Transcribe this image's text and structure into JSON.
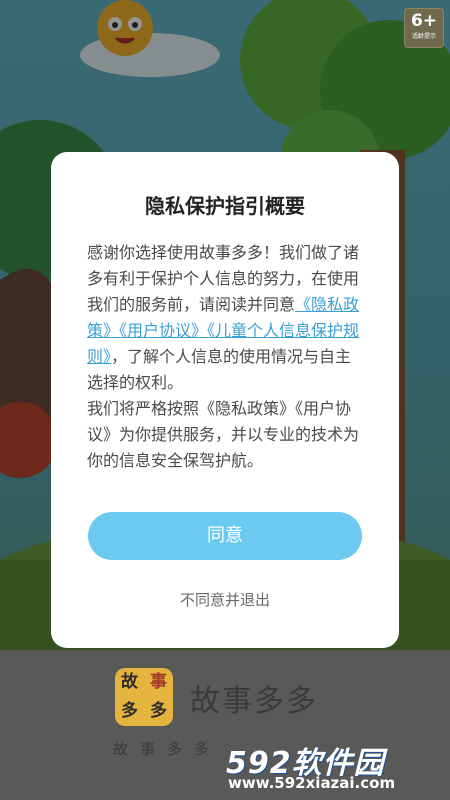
{
  "age_badge": {
    "rating": "6+",
    "caption": "适龄提示"
  },
  "dialog": {
    "title": "隐私保护指引概要",
    "body": {
      "intro": "感谢你选择使用故事多多！我们做了诸多有利于保护个人信息的努力，在使用我们的服务前，请阅读并同意",
      "link_privacy": "《隐私政策》",
      "link_user_agreement": "《用户协议》",
      "link_child_rules": "《儿童个人信息保护规则》",
      "after_links": "，了解个人信息的使用情况与自主选择的权利。",
      "second_paragraph": "我们将严格按照《隐私政策》《用户协议》为你提供服务，并以专业的技术为你的信息安全保驾护航。"
    },
    "agree_label": "同意",
    "decline_label": "不同意并退出"
  },
  "app": {
    "logo_chars": [
      "故",
      "事",
      "多",
      "多"
    ],
    "title": "故事多多",
    "slogan": "故事多多"
  },
  "watermark": {
    "brand": "592软件园",
    "url": "www.592xiazai.com"
  },
  "colors": {
    "accent": "#6ccaf1",
    "link": "#3b9fd8",
    "logo_bg": "#e4b43f"
  }
}
